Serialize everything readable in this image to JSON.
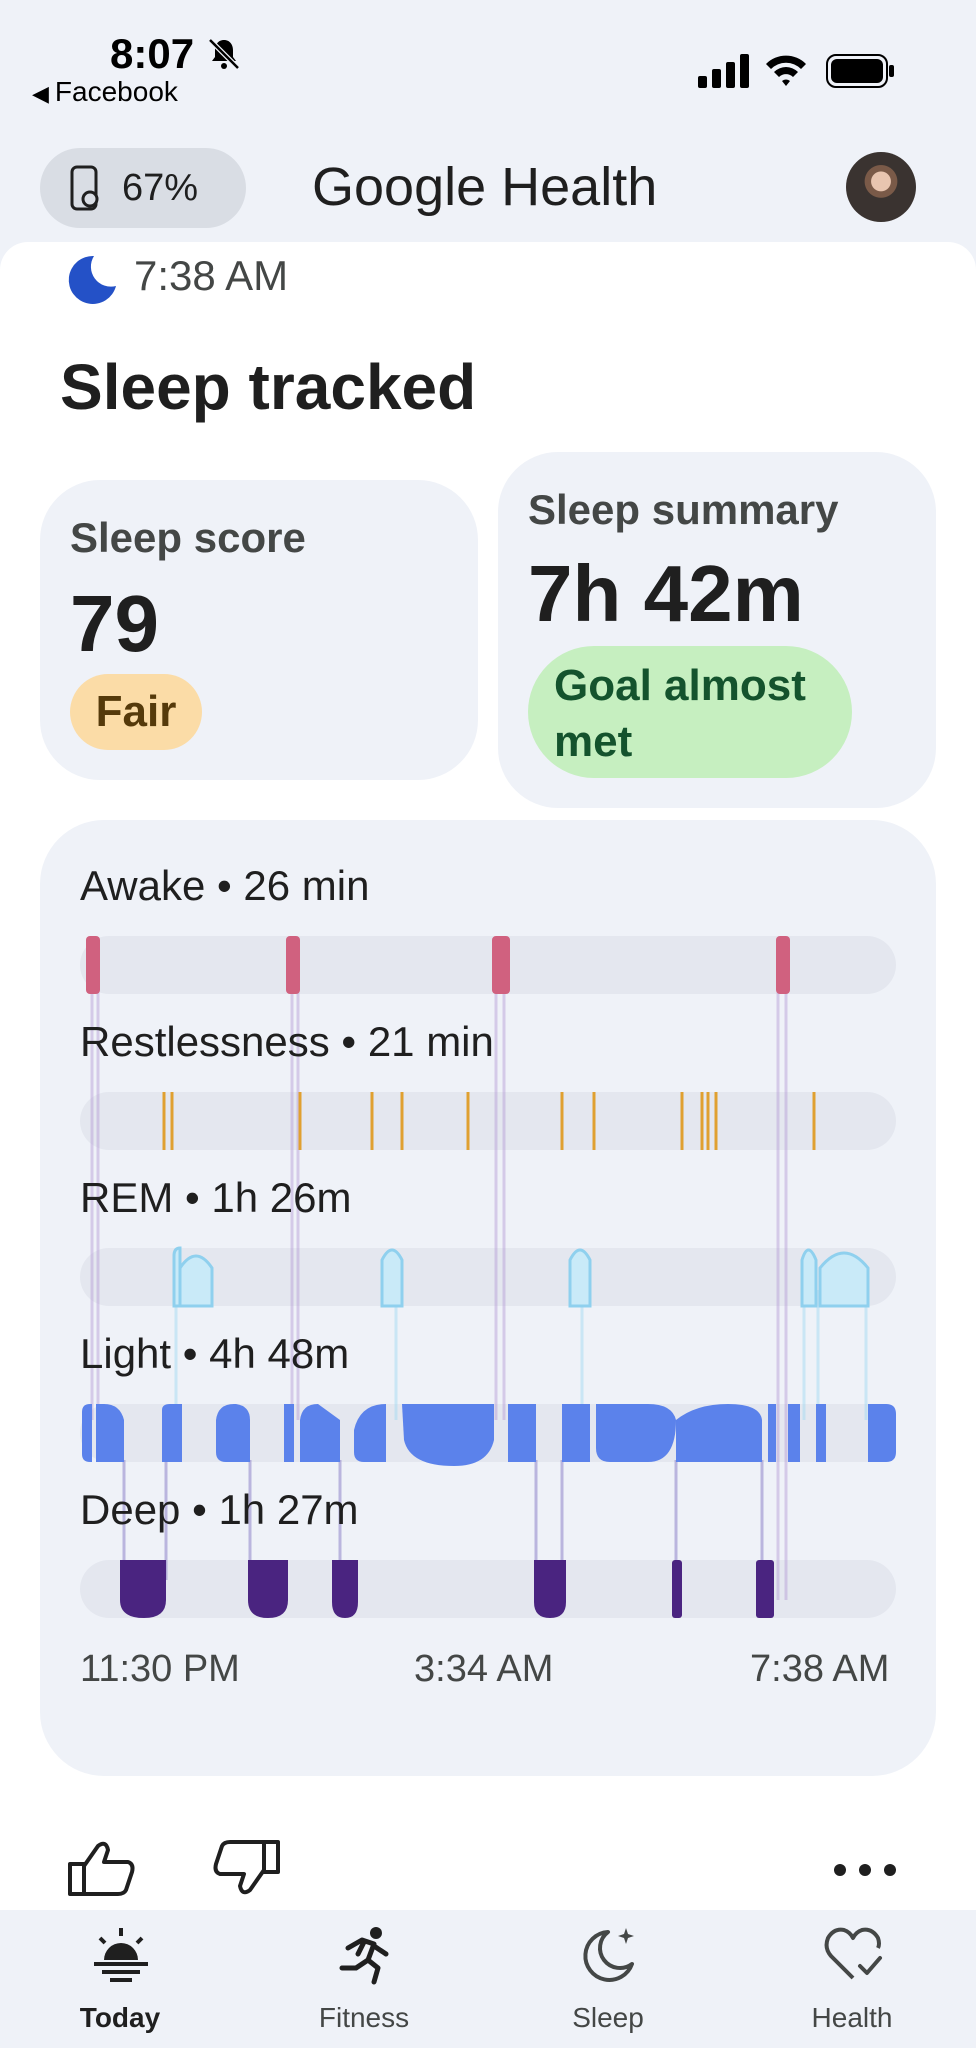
{
  "status_bar": {
    "time": "8:07",
    "back_app": "Facebook"
  },
  "header": {
    "device_battery": "67%",
    "app_title": "Google Health"
  },
  "sleep_card": {
    "wake_time": "7:38 AM",
    "title": "Sleep tracked",
    "score_tile": {
      "label": "Sleep score",
      "value": "79",
      "badge": "Fair"
    },
    "summary_tile": {
      "label": "Sleep summary",
      "value": "7h 42m",
      "badge": "Goal almost met"
    },
    "stages": [
      {
        "name": "Awake",
        "duration": "26 min"
      },
      {
        "name": "Restlessness",
        "duration": "21 min"
      },
      {
        "name": "REM",
        "duration": "1h 26m"
      },
      {
        "name": "Light",
        "duration": "4h 48m"
      },
      {
        "name": "Deep",
        "duration": "1h 27m"
      }
    ],
    "time_axis": [
      "11:30 PM",
      "3:34 AM",
      "7:38 AM"
    ],
    "colors": {
      "awake": "#d0617f",
      "restless": "#e0a030",
      "rem": "#9fd8f2",
      "light": "#5b82eb",
      "deep": "#4a2480"
    }
  },
  "nav": {
    "items": [
      {
        "label": "Today",
        "icon": "sunrise-icon",
        "active": true
      },
      {
        "label": "Fitness",
        "icon": "running-icon",
        "active": false
      },
      {
        "label": "Sleep",
        "icon": "moon-stars-icon",
        "active": false
      },
      {
        "label": "Health",
        "icon": "heart-check-icon",
        "active": false
      }
    ]
  }
}
